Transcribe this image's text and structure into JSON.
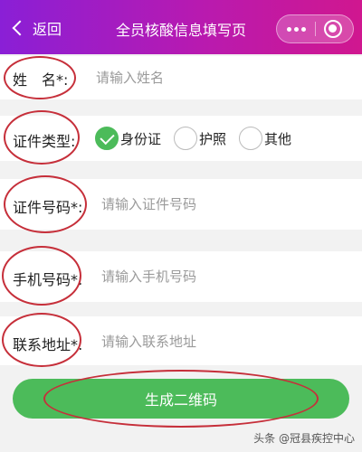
{
  "header": {
    "back_label": "返回",
    "title": "全员核酸信息填写页",
    "more_icon": "more-dots-icon",
    "close_icon": "target-circle-icon"
  },
  "form": {
    "name": {
      "label": "姓　名*:",
      "placeholder": "请输入姓名"
    },
    "id_type": {
      "label": "证件类型:",
      "options": [
        {
          "label": "身份证",
          "checked": true
        },
        {
          "label": "护照",
          "checked": false
        },
        {
          "label": "其他",
          "checked": false
        }
      ]
    },
    "id_number": {
      "label": "证件号码*:",
      "placeholder": "请输入证件号码"
    },
    "phone": {
      "label": "手机号码*:",
      "placeholder": "请输入手机号码"
    },
    "address": {
      "label": "联系地址*:",
      "placeholder": "请输入联系地址"
    }
  },
  "submit": {
    "label": "生成二维码"
  },
  "watermark": "头条 @冠县疾控中心",
  "colors": {
    "accent_green": "#4cbb5a",
    "annotation_red": "#c62f3a",
    "header_start": "#8a1fd6",
    "header_end": "#d0178f"
  }
}
